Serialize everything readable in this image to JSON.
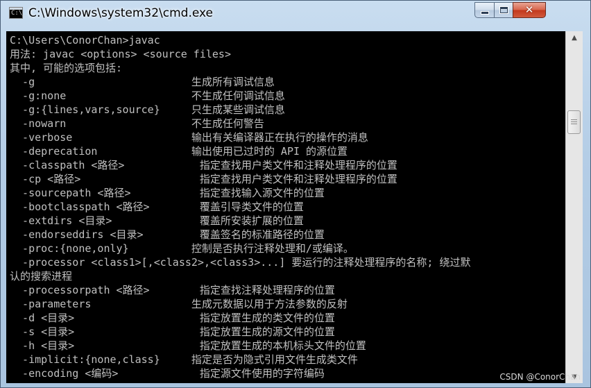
{
  "window": {
    "title": "C:\\Windows\\system32\\cmd.exe",
    "icon": "console-app-icon",
    "icon_prompt": "C:\\_",
    "controls": {
      "minimize_icon": "minimize-icon",
      "maximize_icon": "maximize-icon",
      "close_icon": "close-icon",
      "close_glyph": "✕"
    }
  },
  "console": {
    "background": "#000000",
    "foreground": "#c0c0c0",
    "lines": [
      "C:\\Users\\ConorChan>javac",
      "用法: javac <options> <source files>",
      "其中, 可能的选项包括:",
      "  -g                         生成所有调试信息",
      "  -g:none                    不生成任何调试信息",
      "  -g:{lines,vars,source}     只生成某些调试信息",
      "  -nowarn                    不生成任何警告",
      "  -verbose                   输出有关编译器正在执行的操作的消息",
      "  -deprecation               输出使用已过时的 API 的源位置",
      "  -classpath <路径>            指定查找用户类文件和注释处理程序的位置",
      "  -cp <路径>                   指定查找用户类文件和注释处理程序的位置",
      "  -sourcepath <路径>           指定查找输入源文件的位置",
      "  -bootclasspath <路径>        覆盖引导类文件的位置",
      "  -extdirs <目录>              覆盖所安装扩展的位置",
      "  -endorseddirs <目录>         覆盖签名的标准路径的位置",
      "  -proc:{none,only}          控制是否执行注释处理和/或编译。",
      "  -processor <class1>[,<class2>,<class3>...] 要运行的注释处理程序的名称; 绕过默",
      "认的搜索进程",
      "  -processorpath <路径>        指定查找注释处理程序的位置",
      "  -parameters                生成元数据以用于方法参数的反射",
      "  -d <目录>                    指定放置生成的类文件的位置",
      "  -s <目录>                    指定放置生成的源文件的位置",
      "  -h <目录>                    指定放置生成的本机标头文件的位置",
      "  -implicit:{none,class}     指定是否为隐式引用文件生成类文件",
      "  -encoding <编码>             指定源文件使用的字符编码"
    ]
  },
  "scrollbar": {
    "up_arrow": "▲",
    "down_arrow": "▼",
    "position_fraction": 0.22
  },
  "watermark": {
    "text": "CSDN @ConorChan"
  }
}
